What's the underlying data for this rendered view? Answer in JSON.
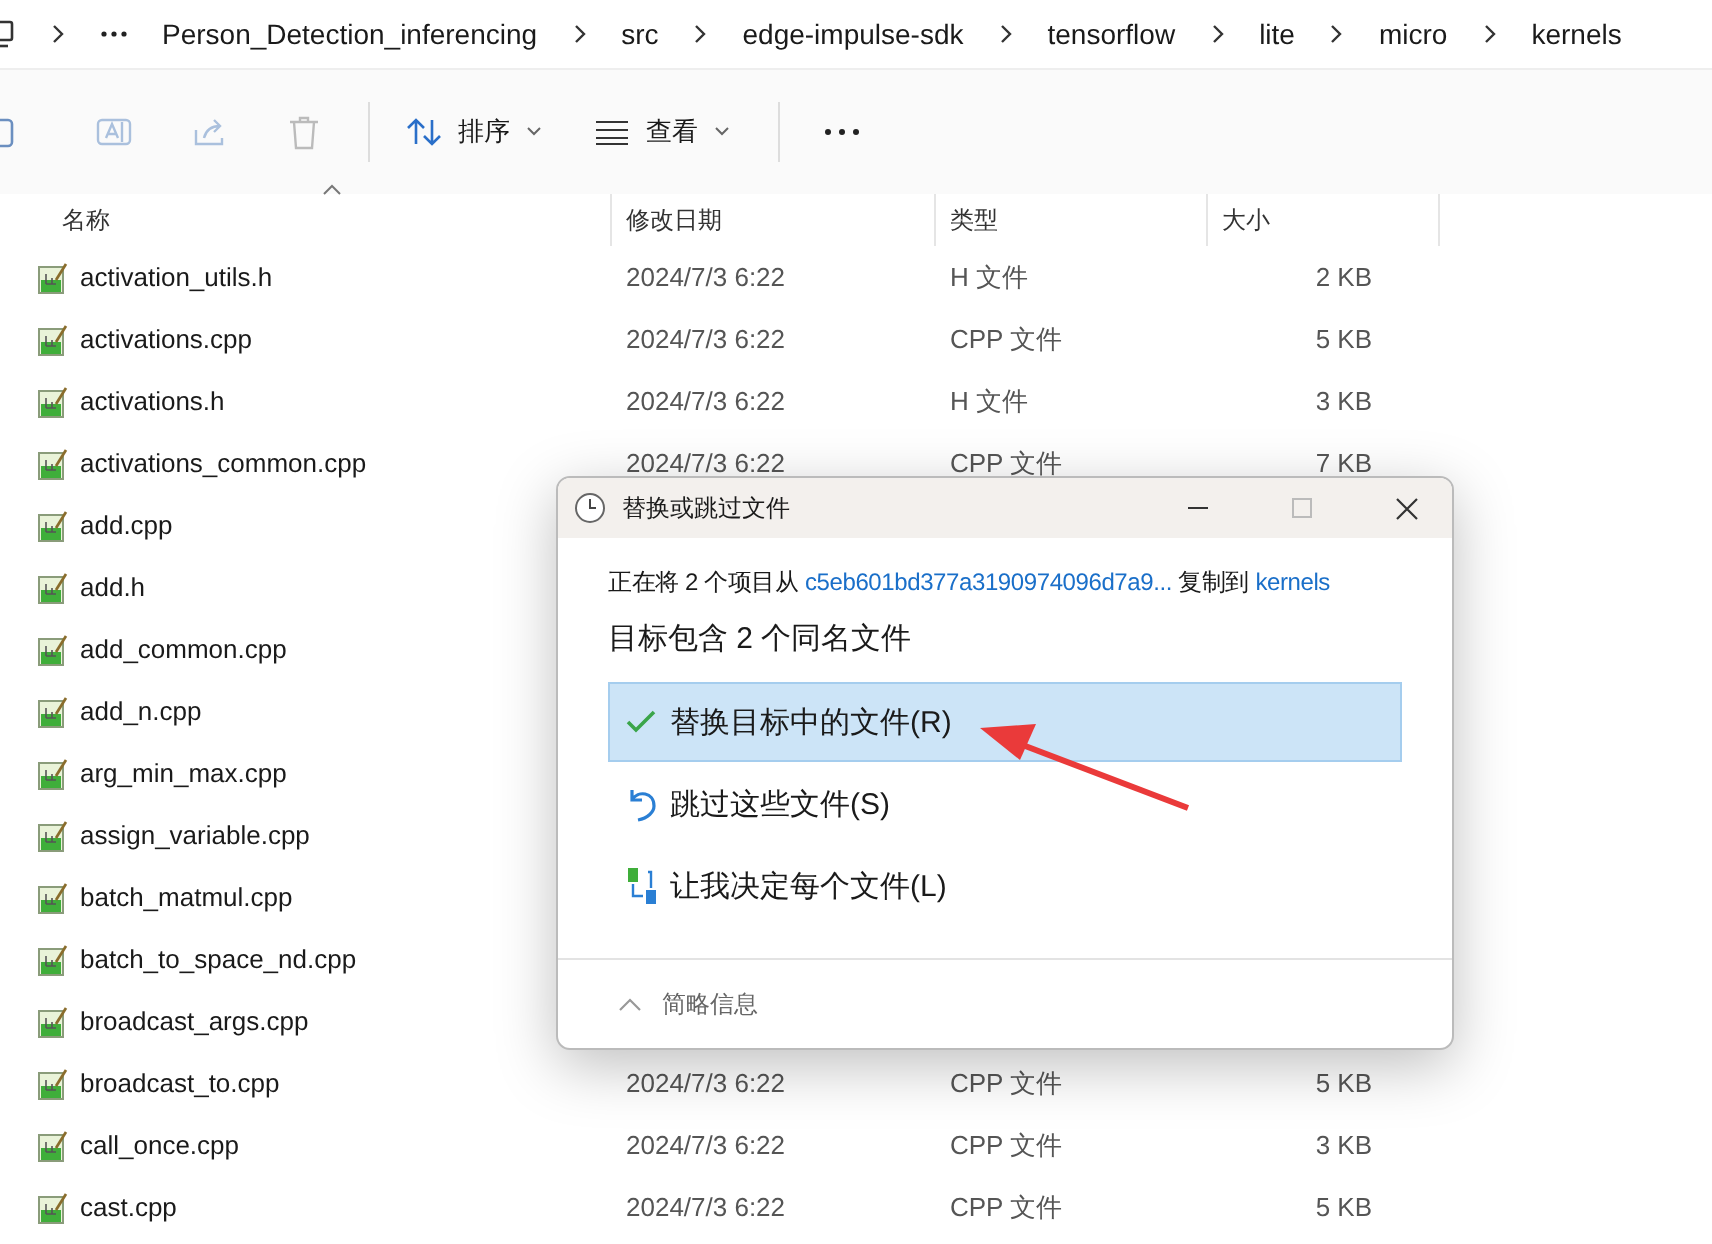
{
  "breadcrumb": [
    "Person_Detection_inferencing",
    "src",
    "edge-impulse-sdk",
    "tensorflow",
    "lite",
    "micro",
    "kernels"
  ],
  "toolbar": {
    "sort": "排序",
    "view": "查看"
  },
  "table": {
    "columns": [
      "名称",
      "修改日期",
      "类型",
      "大小"
    ],
    "rows": [
      {
        "name": "activation_utils.h",
        "date": "2024/7/3 6:22",
        "type": "H 文件",
        "size": "2 KB"
      },
      {
        "name": "activations.cpp",
        "date": "2024/7/3 6:22",
        "type": "CPP 文件",
        "size": "5 KB"
      },
      {
        "name": "activations.h",
        "date": "2024/7/3 6:22",
        "type": "H 文件",
        "size": "3 KB"
      },
      {
        "name": "activations_common.cpp",
        "date": "2024/7/3 6:22",
        "type": "CPP 文件",
        "size": "7 KB"
      },
      {
        "name": "add.cpp"
      },
      {
        "name": "add.h"
      },
      {
        "name": "add_common.cpp"
      },
      {
        "name": "add_n.cpp"
      },
      {
        "name": "arg_min_max.cpp"
      },
      {
        "name": "assign_variable.cpp"
      },
      {
        "name": "batch_matmul.cpp"
      },
      {
        "name": "batch_to_space_nd.cpp"
      },
      {
        "name": "broadcast_args.cpp"
      },
      {
        "name": "broadcast_to.cpp",
        "date": "2024/7/3 6:22",
        "type": "CPP 文件",
        "size": "5 KB"
      },
      {
        "name": "call_once.cpp",
        "date": "2024/7/3 6:22",
        "type": "CPP 文件",
        "size": "3 KB"
      },
      {
        "name": "cast.cpp",
        "date": "2024/7/3 6:22",
        "type": "CPP 文件",
        "size": "5 KB"
      }
    ]
  },
  "dialog": {
    "title": "替换或跳过文件",
    "message": {
      "before": "正在将 2 个项目从 ",
      "source": "c5eb601bd377a3190974096d7a9...",
      "middle": " 复制到 ",
      "target": "kernels"
    },
    "heading": "目标包含 2 个同名文件",
    "options": [
      {
        "kind": "replace",
        "label": "替换目标中的文件(R)",
        "selected": true
      },
      {
        "kind": "skip",
        "label": "跳过这些文件(S)",
        "selected": false
      },
      {
        "kind": "decide",
        "label": "让我决定每个文件(L)",
        "selected": false
      }
    ],
    "details": "简略信息"
  }
}
